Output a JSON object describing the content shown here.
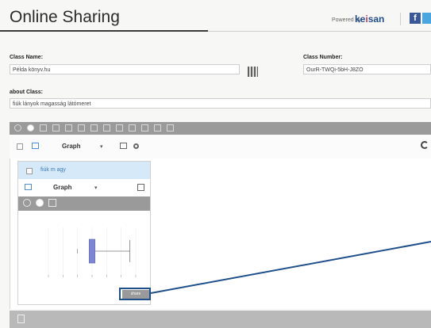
{
  "header": {
    "title": "Online Sharing",
    "powered_by": "Powered by",
    "brand_prefix": "ke",
    "brand_highlight": "i",
    "brand_suffix": "san",
    "facebook_label": "f"
  },
  "form": {
    "class_name_label": "Class Name:",
    "class_name_value": "Példa könyv.hu",
    "class_number_label": "Class Number:",
    "class_number_value": "OurR-TWQi-5bH-J8ZO",
    "about_label": "about Class:",
    "about_value": "fiúk lányok magasság látómeret"
  },
  "toolbar": {
    "graph_label": "Graph",
    "caret": "▾"
  },
  "card": {
    "title": "fiúk m agy",
    "graph_label": "Graph",
    "caret": "▾",
    "button_label": "share"
  },
  "colors": {
    "accent": "#1f4f8b",
    "toolbar": "#9a9a9a",
    "card_header": "#d6e9f8",
    "box_fill": "#7d86d6"
  },
  "icons": {
    "qr": "qr-code-icon",
    "refresh": "refresh-icon",
    "expand": "expand-icon",
    "settings": "gear-icon"
  },
  "chart_data": {
    "type": "box",
    "series": [
      {
        "min": 700,
        "q1": 740,
        "median": 760,
        "q3": 760,
        "max": 880
      }
    ],
    "xlim": [
      600,
      900
    ]
  }
}
